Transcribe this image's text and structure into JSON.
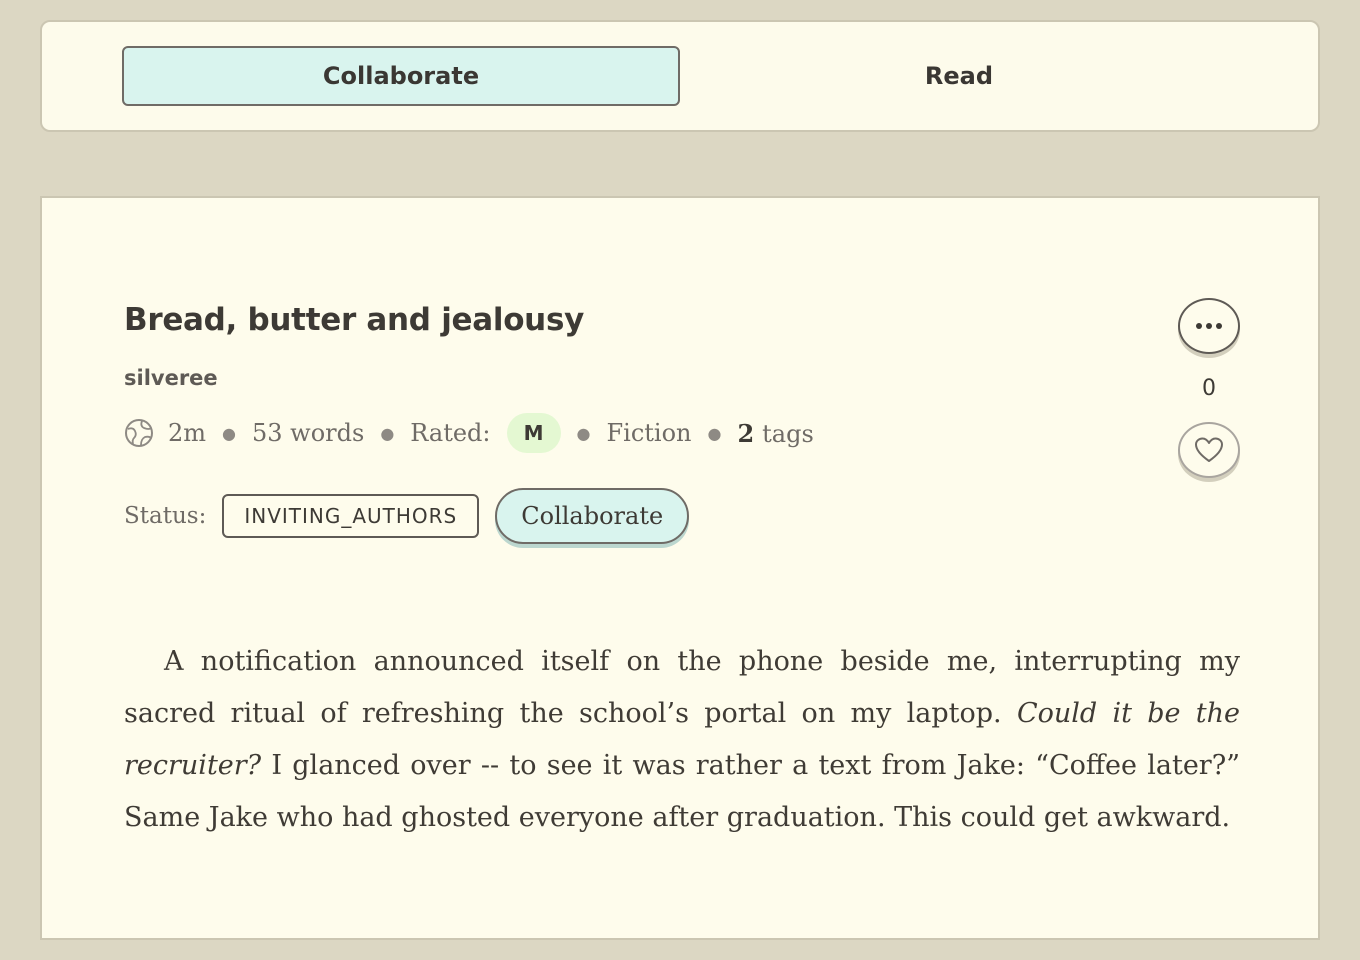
{
  "tabs": [
    {
      "label": "Collaborate",
      "active": true
    },
    {
      "label": "Read",
      "active": false
    }
  ],
  "story": {
    "title": "Bread, butter and jealousy",
    "author": "silveree",
    "meta": {
      "read_time": "2m",
      "word_count": "53 words",
      "rated_label": "Rated:",
      "rating": "M",
      "genre": "Fiction",
      "tags_count": "2",
      "tags_label": "tags"
    },
    "status_label": "Status:",
    "status_value": "INVITING_AUTHORS",
    "collaborate_label": "Collaborate",
    "likes": "0",
    "excerpt": {
      "part1": "A notification announced itself on the phone beside me, interrupting my sacred ritual of refreshing the school’s portal on my laptop. ",
      "italic": "Could it be the recruiter?",
      "part2": " I glanced over -- to see it was rather a text from Jake: “Coffee later?” Same Jake who had ghosted everyone after graduation. This could get awkward."
    }
  },
  "icons": {
    "visibility": "globe-icon",
    "more": "more-horizontal-icon",
    "like": "heart-icon"
  },
  "colors": {
    "background": "#dcd7c3",
    "card": "#fefcec",
    "accent": "#d9f4ee",
    "rating_badge": "#e4f8d2"
  }
}
